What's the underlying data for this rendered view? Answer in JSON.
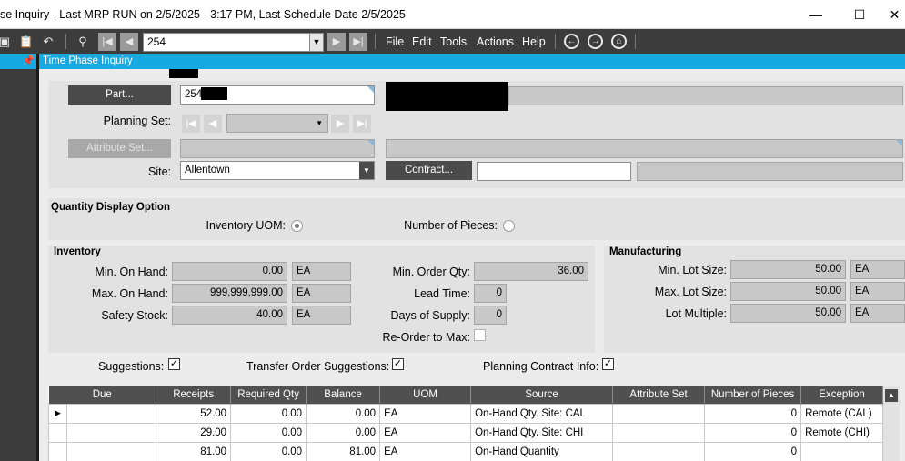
{
  "window": {
    "title": "se Inquiry  - Last MRP RUN on 2/5/2025 - 3:17 PM, Last Schedule Date  2/5/2025",
    "minimize": "—",
    "maximize": "☐",
    "close": "✕"
  },
  "toolbar": {
    "record_value": "254",
    "menus": [
      "File",
      "Edit",
      "Tools",
      "Actions",
      "Help"
    ]
  },
  "tab_title": "Time Phase Inquiry",
  "header": {
    "part_button": "Part...",
    "part_value": "254",
    "planning_set_label": "Planning Set:",
    "attribute_set_button": "Attribute Set...",
    "site_label": "Site:",
    "site_value": "Allentown",
    "contract_button": "Contract..."
  },
  "quantity_display": {
    "heading": "Quantity Display Option",
    "inventory_uom_label": "Inventory UOM:",
    "inventory_uom_selected": true,
    "pieces_label": "Number of Pieces:",
    "pieces_selected": false
  },
  "inventory": {
    "heading": "Inventory",
    "min_on_hand_label": "Min. On Hand:",
    "min_on_hand": "0.00",
    "min_on_hand_uom": "EA",
    "max_on_hand_label": "Max. On Hand:",
    "max_on_hand": "999,999,999.00",
    "max_on_hand_uom": "EA",
    "safety_stock_label": "Safety Stock:",
    "safety_stock": "40.00",
    "safety_stock_uom": "EA",
    "min_order_qty_label": "Min. Order Qty:",
    "min_order_qty": "36.00",
    "lead_time_label": "Lead Time:",
    "lead_time": "0",
    "days_supply_label": "Days of Supply:",
    "days_supply": "0",
    "reorder_max_label": "Re-Order to Max:",
    "reorder_max": false
  },
  "manufacturing": {
    "heading": "Manufacturing",
    "min_lot_label": "Min. Lot Size:",
    "min_lot": "50.00",
    "min_lot_uom": "EA",
    "max_lot_label": "Max. Lot Size:",
    "max_lot": "50.00",
    "max_lot_uom": "EA",
    "lot_multiple_label": "Lot Multiple:",
    "lot_multiple": "50.00",
    "lot_multiple_uom": "EA"
  },
  "options": {
    "suggestions_label": "Suggestions:",
    "suggestions": true,
    "transfer_label": "Transfer Order Suggestions:",
    "transfer": true,
    "planning_contract_label": "Planning Contract Info:",
    "planning_contract": true
  },
  "grid": {
    "columns": [
      "Due",
      "Receipts",
      "Required Qty",
      "Balance",
      "UOM",
      "Source",
      "Attribute Set",
      "Number of Pieces",
      "Exception"
    ],
    "rows": [
      {
        "marker": "▶",
        "due": "",
        "receipts": "52.00",
        "required": "0.00",
        "balance": "0.00",
        "uom": "EA",
        "source": "On-Hand Qty. Site: CAL",
        "attribute_set": "",
        "pieces": "0",
        "exception": "Remote (CAL)"
      },
      {
        "marker": "",
        "due": "",
        "receipts": "29.00",
        "required": "0.00",
        "balance": "0.00",
        "uom": "EA",
        "source": "On-Hand Qty. Site: CHI",
        "attribute_set": "",
        "pieces": "0",
        "exception": "Remote (CHI)"
      },
      {
        "marker": "",
        "due": "",
        "receipts": "81.00",
        "required": "0.00",
        "balance": "81.00",
        "uom": "EA",
        "source": "On-Hand Quantity",
        "attribute_set": "",
        "pieces": "0",
        "exception": ""
      }
    ]
  }
}
